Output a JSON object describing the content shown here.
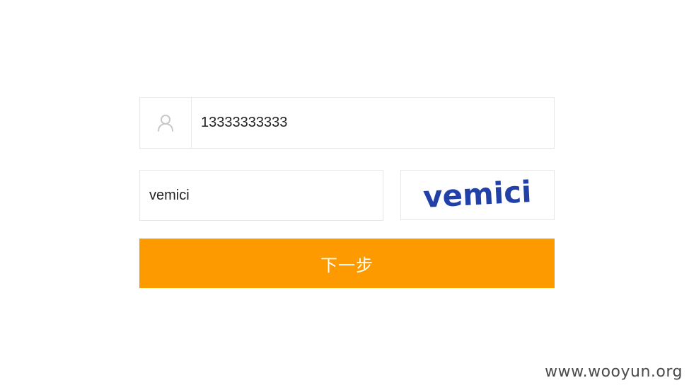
{
  "form": {
    "phone_value": "13333333333",
    "captcha_value": "vemici",
    "captcha_image_text": "vemici",
    "next_label": "下一步"
  },
  "watermark": "www.wooyun.org",
  "colors": {
    "accent": "#fd9a00",
    "border": "#e6e6e6",
    "captcha_text": "#2141a8",
    "icon": "#c8c8c8"
  },
  "icons": {
    "phone_field": "user-icon"
  }
}
